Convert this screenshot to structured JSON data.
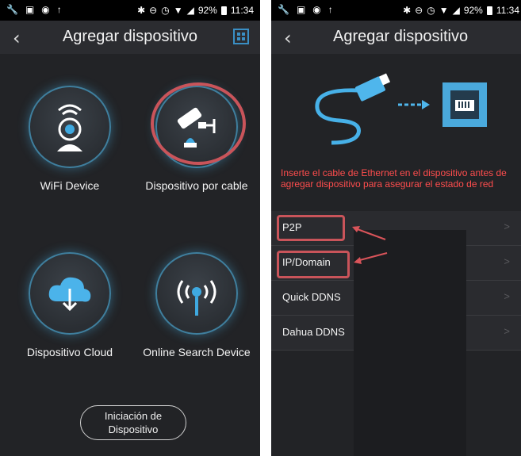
{
  "status_bar": {
    "battery": "92%",
    "time": "11:34"
  },
  "left_screen": {
    "title": "Agregar dispositivo",
    "options": [
      {
        "label": "WiFi Device",
        "icon": "wifi-camera-icon"
      },
      {
        "label": "Dispositivo por cable",
        "icon": "wired-camera-icon"
      },
      {
        "label": "Dispositivo Cloud",
        "icon": "cloud-download-icon"
      },
      {
        "label": "Online Search Device",
        "icon": "broadcast-search-icon"
      }
    ],
    "init_button": {
      "line1": "Iniciación de",
      "line2": "Dispositivo"
    }
  },
  "right_screen": {
    "title": "Agregar dispositivo",
    "notice": "Inserte el cable de Ethernet en el dispositivo antes de agregar dispositivo para asegurar el estado de red",
    "methods": [
      {
        "label": "P2P"
      },
      {
        "label": "IP/Domain"
      },
      {
        "label": "Quick DDNS"
      },
      {
        "label": "Dahua DDNS"
      }
    ],
    "chevron": ">"
  },
  "colors": {
    "accent_ring": "#3f7f9e",
    "highlight": "#c9545a",
    "warning": "#ff4d4d",
    "background": "#222326"
  }
}
